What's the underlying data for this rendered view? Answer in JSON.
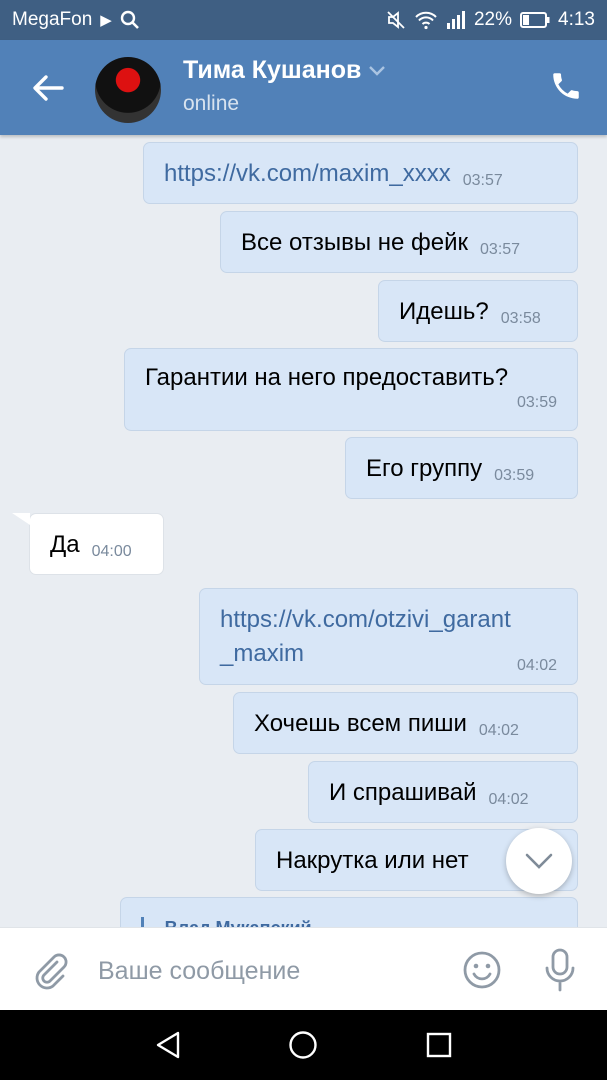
{
  "status_bar": {
    "carrier": "MegaFon",
    "battery": "22%",
    "time": "4:13"
  },
  "header": {
    "name": "Тима Кушанов",
    "status": "online"
  },
  "messages": [
    {
      "text": "https://vk.com/maxim_xxxx",
      "time": "03:57",
      "direction": "out",
      "is_link": true
    },
    {
      "text": "Все отзывы не фейк",
      "time": "03:57",
      "direction": "out"
    },
    {
      "text": "Идешь?",
      "time": "03:58",
      "direction": "out"
    },
    {
      "text": "Гарантии на него предоставить?",
      "time": "03:59",
      "direction": "out"
    },
    {
      "text": "Его группу",
      "time": "03:59",
      "direction": "out"
    },
    {
      "text": "Да",
      "time": "04:00",
      "direction": "in"
    },
    {
      "text_line1": "https://vk.com/otzivi_garant",
      "text_line2": "_maxim",
      "time": "04:02",
      "direction": "out",
      "is_link": true
    },
    {
      "text": "Хочешь всем пиши",
      "time": "04:02",
      "direction": "out"
    },
    {
      "text": "И спрашивай",
      "time": "04:02",
      "direction": "out"
    },
    {
      "text": "Накрутка или нет",
      "time": "",
      "direction": "out"
    },
    {
      "text": "Влад Мукапский",
      "direction": "out",
      "forwarded": true
    }
  ],
  "composer": {
    "placeholder": "Ваше сообщение"
  },
  "colors": {
    "status_bar": "#3f5f83",
    "app_bar": "#5181b8",
    "chat_bg": "#e9edf2",
    "bubble_out": "#d8e6f7",
    "bubble_in": "#ffffff",
    "link": "#3f6aa0"
  },
  "icons": {
    "back": "arrow-left-icon",
    "call": "phone-icon",
    "attach": "paperclip-icon",
    "emoji": "smiley-icon",
    "mic": "microphone-icon",
    "scroll": "chevron-down-icon"
  }
}
